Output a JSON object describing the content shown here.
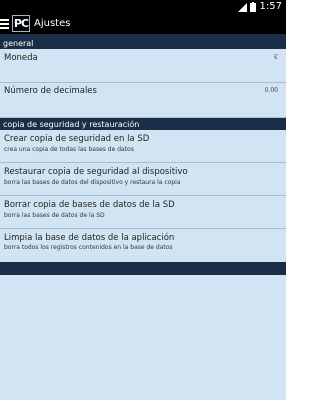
{
  "status_bar": {
    "time": "1:57",
    "icons": [
      "signal-icon",
      "battery-icon"
    ]
  },
  "action_bar": {
    "logo_text": "PC",
    "title": "Ajustes"
  },
  "sections": {
    "general": {
      "header": "general",
      "items": [
        {
          "label": "Moneda",
          "value": "€"
        },
        {
          "label": "Número de decimales",
          "value": "0.00"
        }
      ]
    },
    "backup": {
      "header": "copia de seguridad y restauración",
      "items": [
        {
          "label": "Crear copia de seguridad en la SD",
          "summary": "crea una copia de todas las bases de datos"
        },
        {
          "label": "Restaurar copia de seguridad al dispositivo",
          "summary": "borra las bases de datos del dispositivo y restaura la copia"
        },
        {
          "label": "Borrar copia de bases de datos de la SD",
          "summary": "borra las bases de datos de la SD"
        },
        {
          "label": "Limpia la base de datos de la aplicación",
          "summary": "borra todos los registros contenidos en la base de datos"
        }
      ]
    }
  },
  "colors": {
    "header_bg": "#1a2f47",
    "content_bg": "#d2e4f3",
    "bar_bg": "#000000"
  }
}
